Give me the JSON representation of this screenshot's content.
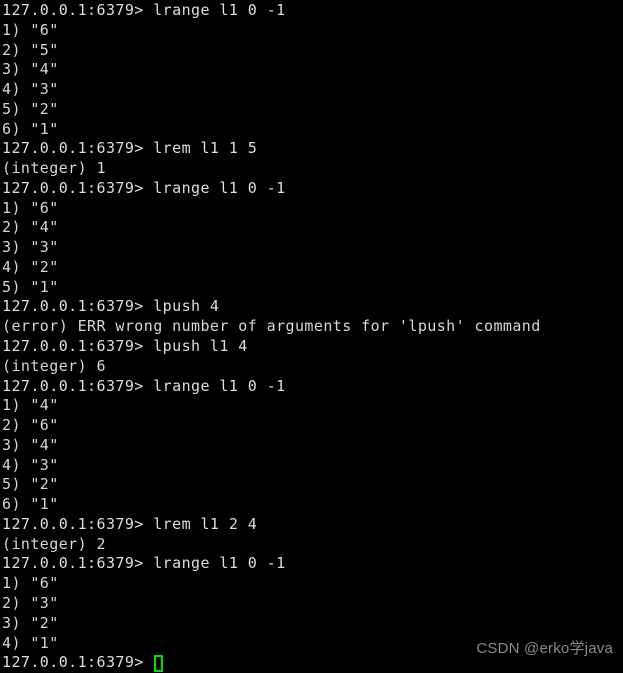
{
  "terminal": {
    "app": "redis-cli",
    "prompt": "127.0.0.1:6379>",
    "background_color": "#000000",
    "text_color": "#d8d8d8",
    "cursor_color": "#00e000",
    "lines": [
      {
        "kind": "prompt",
        "text": "127.0.0.1:6379> lrange l1 0 -1"
      },
      {
        "kind": "result",
        "text": "1) \"6\""
      },
      {
        "kind": "result",
        "text": "2) \"5\""
      },
      {
        "kind": "result",
        "text": "3) \"4\""
      },
      {
        "kind": "result",
        "text": "4) \"3\""
      },
      {
        "kind": "result",
        "text": "5) \"2\""
      },
      {
        "kind": "result",
        "text": "6) \"1\""
      },
      {
        "kind": "prompt",
        "text": "127.0.0.1:6379> lrem l1 1 5"
      },
      {
        "kind": "result",
        "text": "(integer) 1"
      },
      {
        "kind": "prompt",
        "text": "127.0.0.1:6379> lrange l1 0 -1"
      },
      {
        "kind": "result",
        "text": "1) \"6\""
      },
      {
        "kind": "result",
        "text": "2) \"4\""
      },
      {
        "kind": "result",
        "text": "3) \"3\""
      },
      {
        "kind": "result",
        "text": "4) \"2\""
      },
      {
        "kind": "result",
        "text": "5) \"1\""
      },
      {
        "kind": "prompt",
        "text": "127.0.0.1:6379> lpush 4"
      },
      {
        "kind": "error",
        "text": "(error) ERR wrong number of arguments for 'lpush' command"
      },
      {
        "kind": "prompt",
        "text": "127.0.0.1:6379> lpush l1 4"
      },
      {
        "kind": "result",
        "text": "(integer) 6"
      },
      {
        "kind": "prompt",
        "text": "127.0.0.1:6379> lrange l1 0 -1"
      },
      {
        "kind": "result",
        "text": "1) \"4\""
      },
      {
        "kind": "result",
        "text": "2) \"6\""
      },
      {
        "kind": "result",
        "text": "3) \"4\""
      },
      {
        "kind": "result",
        "text": "4) \"3\""
      },
      {
        "kind": "result",
        "text": "5) \"2\""
      },
      {
        "kind": "result",
        "text": "6) \"1\""
      },
      {
        "kind": "prompt",
        "text": "127.0.0.1:6379> lrem l1 2 4"
      },
      {
        "kind": "result",
        "text": "(integer) 2"
      },
      {
        "kind": "prompt",
        "text": "127.0.0.1:6379> lrange l1 0 -1"
      },
      {
        "kind": "result",
        "text": "1) \"6\""
      },
      {
        "kind": "result",
        "text": "2) \"3\""
      },
      {
        "kind": "result",
        "text": "3) \"2\""
      },
      {
        "kind": "result",
        "text": "4) \"1\""
      }
    ],
    "current_line": {
      "prompt_text": "127.0.0.1:6379> ",
      "input_value": ""
    }
  },
  "watermark": {
    "text": "CSDN @erko学java"
  }
}
